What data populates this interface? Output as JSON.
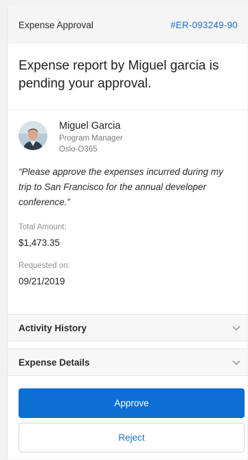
{
  "header": {
    "title": "Expense Approval",
    "report_id": "#ER-093249-90"
  },
  "headline": "Expense report by Miguel garcia is pending your approval.",
  "requester": {
    "name": "Miguel Garcia",
    "role": "Program Manager",
    "org": "Oslo-O365"
  },
  "quote": "“Please approve the expenses incurred during my trip to San Francisco for the annual developer conference.”",
  "total": {
    "label": "Total Amount:",
    "value": "$1,473.35"
  },
  "requested": {
    "label": "Requested on:",
    "value": "09/21/2019"
  },
  "sections": {
    "activity_history": "Activity History",
    "expense_details": "Expense Details"
  },
  "actions": {
    "approve": "Approve",
    "reject": "Reject"
  },
  "colors": {
    "accent": "#0b6fd3",
    "link": "#1a73d9"
  },
  "icons": {
    "avatar": "avatar-photo",
    "chevron": "chevron-down-icon"
  }
}
